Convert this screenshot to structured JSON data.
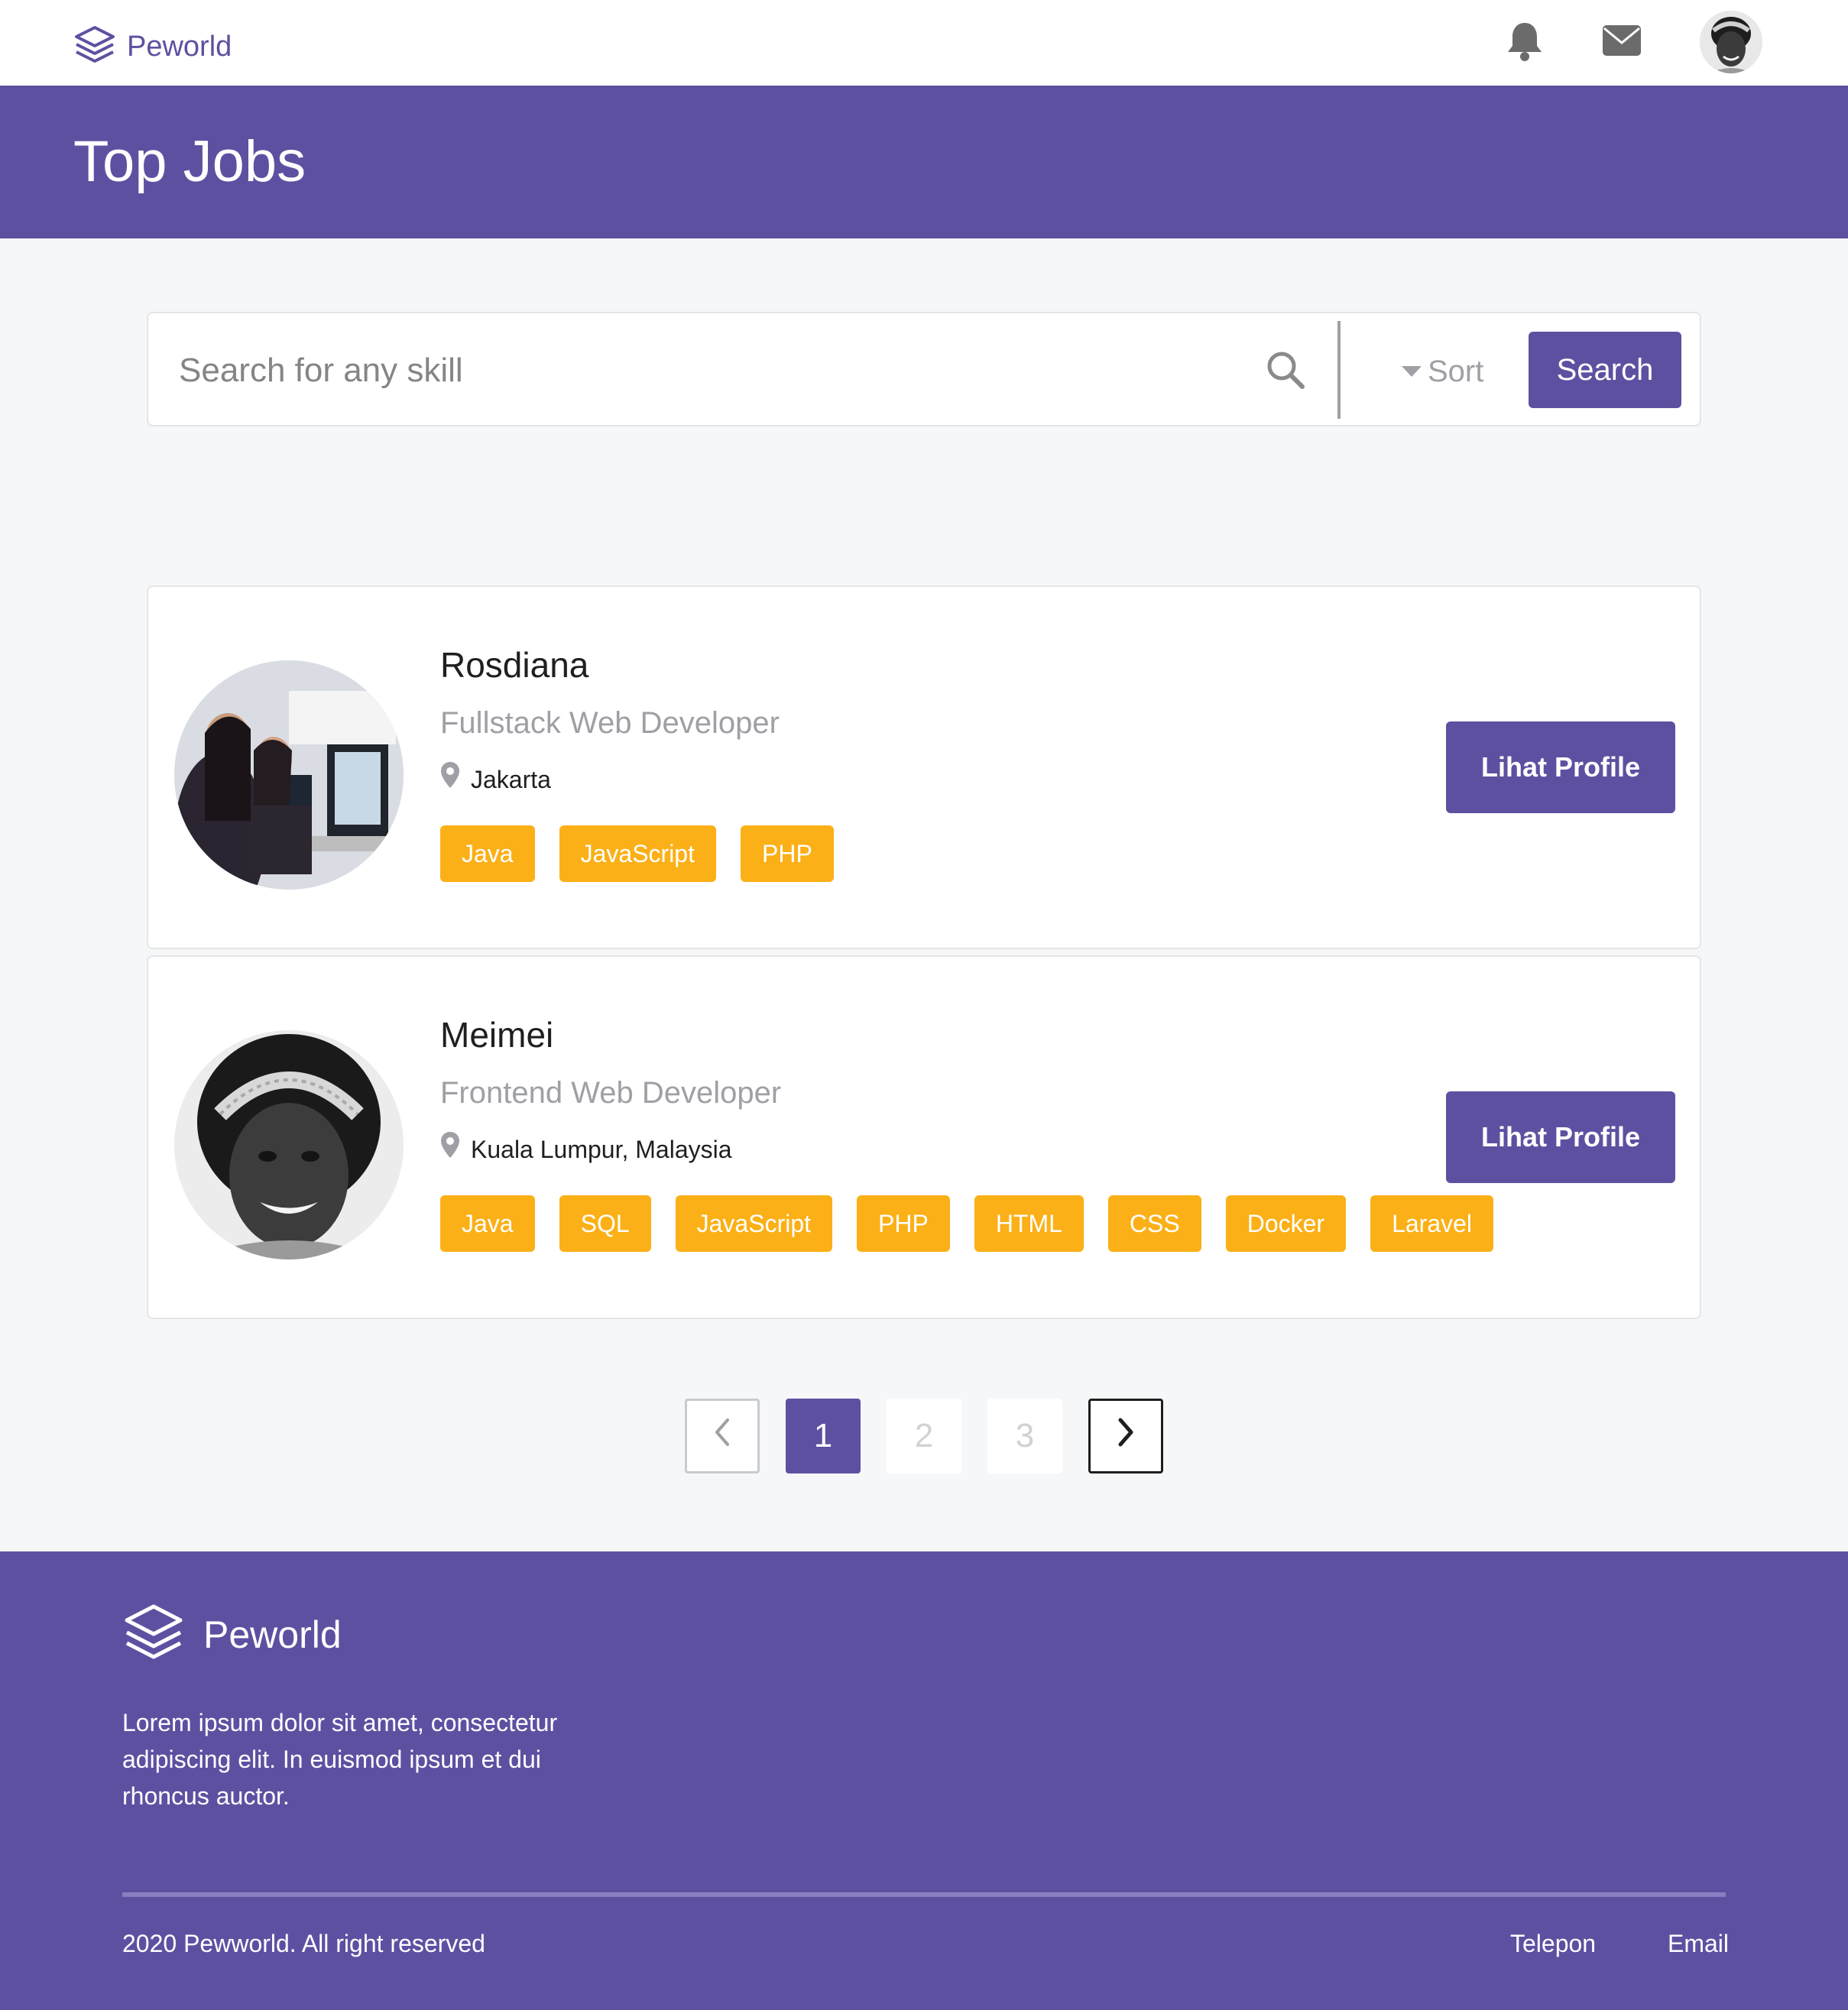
{
  "nav": {
    "brand": "Peworld",
    "icons": [
      "layers-logo-icon",
      "bell-icon",
      "mail-icon"
    ],
    "avatar_alt": ""
  },
  "hero": {
    "title": "Top Jobs"
  },
  "search": {
    "placeholder": "Search for any skill",
    "sort_label": "Sort",
    "button_label": "Search"
  },
  "profiles": [
    {
      "name": "Rosdiana",
      "role": "Fullstack Web Developer",
      "location": "Jakarta",
      "skills": [
        "Java",
        "JavaScript",
        "PHP"
      ],
      "button": "Lihat Profile"
    },
    {
      "name": "Meimei",
      "role": "Frontend Web Developer",
      "location": "Kuala Lumpur, Malaysia",
      "skills": [
        "Java",
        "SQL",
        "JavaScript",
        "PHP",
        "HTML",
        "CSS",
        "Docker",
        "Laravel"
      ],
      "button": "Lihat Profile"
    }
  ],
  "pagination": {
    "pages": [
      "1",
      "2",
      "3"
    ],
    "current": "1"
  },
  "footer": {
    "brand": "Peworld",
    "description": "Lorem ipsum dolor sit amet, consectetur adipiscing elit. In euismod ipsum et dui rhoncus auctor.",
    "copyright": "2020 Pewworld. All right reserved",
    "links": [
      "Telepon",
      "Email"
    ]
  },
  "colors": {
    "primary": "#5e50a1",
    "tag": "#fbb017",
    "muted": "#9ea0a5",
    "background": "#f6f7f8"
  }
}
